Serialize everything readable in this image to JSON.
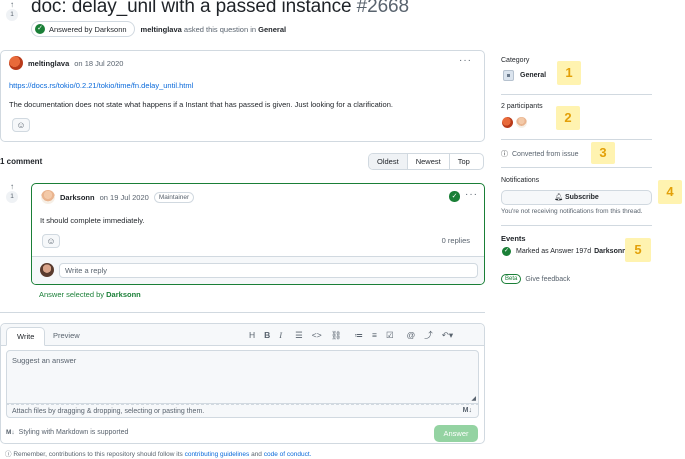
{
  "header": {
    "upvote_count": "1",
    "title": "doc: delay_unil with a passed instance",
    "number": "#2668",
    "answered_label": "Answered by Darksonn",
    "asker": "meltinglava",
    "asked_text": "asked this question in",
    "category": "General"
  },
  "post": {
    "author": "meltinglava",
    "date": "on 18 Jul 2020",
    "link": "https://docs.rs/tokio/0.2.21/tokio/time/fn.delay_until.html",
    "body": "The documentation does not state what happens if a Instant that has passed is given. Just looking for a clarification."
  },
  "comments": {
    "count_label": "1 comment",
    "sort_options": [
      "Oldest",
      "Newest",
      "Top"
    ]
  },
  "answer": {
    "upvote_count": "1",
    "author": "Darksonn",
    "date": "on 19 Jul 2020",
    "role": "Maintainer",
    "body": "It should complete immediately.",
    "replies": "0 replies",
    "reply_placeholder": "Write a reply",
    "selected_prefix": "Answer selected by",
    "selected_by": "Darksonn"
  },
  "composer": {
    "tab_write": "Write",
    "tab_preview": "Preview",
    "placeholder": "Suggest an answer",
    "attach_text": "Attach files by dragging & dropping, selecting or pasting them.",
    "markdown_note": "Styling with Markdown is supported",
    "submit_label": "Answer",
    "reminder_prefix": "Remember, contributions to this repository should follow its",
    "guidelines_link": "contributing guidelines",
    "and": "and",
    "coc_link": "code of conduct."
  },
  "sidebar": {
    "category_heading": "Category",
    "category_value": "General",
    "participants_heading": "2 participants",
    "converted_text": "Converted from issue",
    "notifications_heading": "Notifications",
    "subscribe_label": "Subscribe",
    "notifications_note": "You're not receiving notifications from this thread.",
    "events_heading": "Events",
    "event_text": "Marked as Answer 197d",
    "event_actor": "Darksonn",
    "beta_label": "Beta",
    "feedback_label": "Give feedback"
  },
  "badges": [
    "1",
    "2",
    "3",
    "4",
    "5"
  ],
  "colors": {
    "accent_green": "#1a7f37",
    "link_blue": "#0969da",
    "badge_bg": "#fff3b0",
    "badge_fg": "#e3a008"
  }
}
